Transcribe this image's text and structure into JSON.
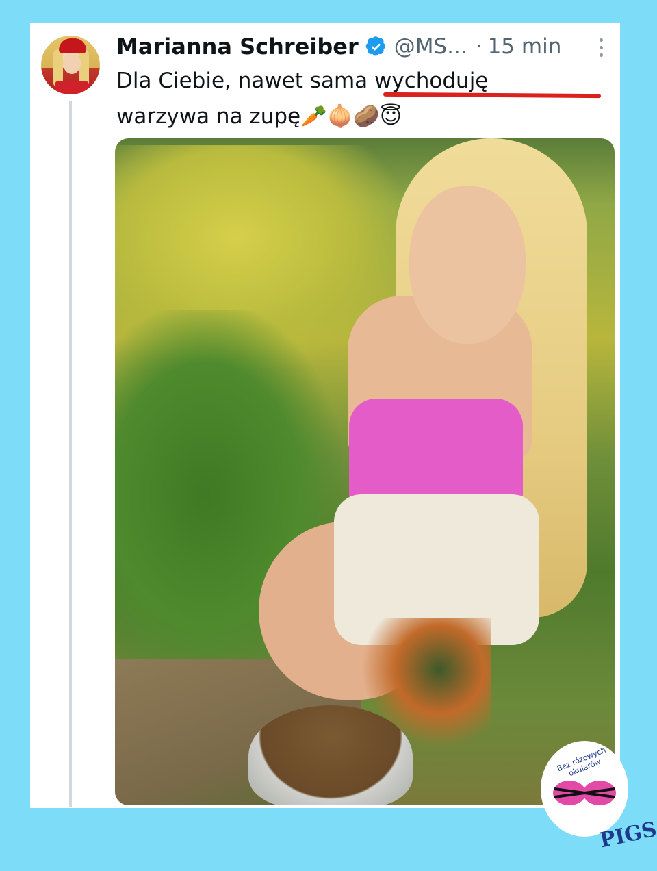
{
  "tweet": {
    "author_name": "Marianna Schreiber",
    "handle": "@MS...",
    "separator": "·",
    "time": "15 min",
    "text_line1": "Dla Ciebie, nawet sama wychoduję",
    "text_line2": "warzywa na zupę🥕🧅🥔😇"
  },
  "watermark": {
    "arc_text": "Bez różowych okularów",
    "brand": "PIGS"
  },
  "colors": {
    "background": "#7ddcf8",
    "verified": "#1d9bf0",
    "underline": "#d9221e"
  }
}
